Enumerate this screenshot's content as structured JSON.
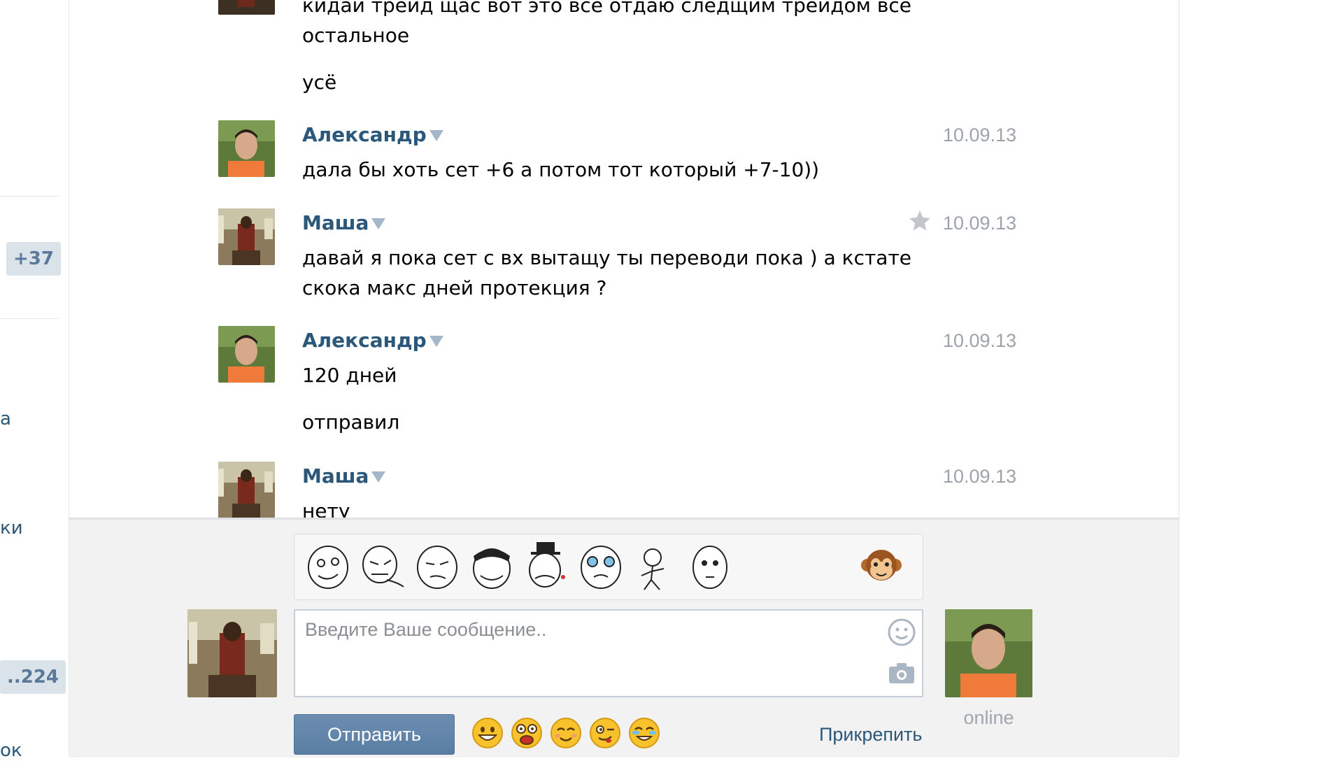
{
  "sidebar": {
    "badge_top": "+37",
    "badge_bottom": "..224",
    "frag_1": "а",
    "frag_2": "ки",
    "frag_3": "ок"
  },
  "messages": [
    {
      "author": "",
      "date": "",
      "texts": [
        "кидаи треид щас вот это все отдаю следщим треидом все остальное",
        "усё"
      ]
    },
    {
      "author": "Александр",
      "date": "10.09.13",
      "texts": [
        "дала бы хоть сет +6 а потом тот который +7-10))"
      ]
    },
    {
      "author": "Маша",
      "date": "10.09.13",
      "texts": [
        "давай я пока сет с вх вытащу ты переводи пока ) а кстате скока макс дней протекция ?"
      ]
    },
    {
      "author": "Александр",
      "date": "10.09.13",
      "texts": [
        "120 дней",
        "отправил"
      ]
    },
    {
      "author": "Маша",
      "date": "10.09.13",
      "texts": [
        "нету"
      ]
    }
  ],
  "composer": {
    "placeholder": "Введите Ваше сообщение..",
    "send_label": "Отправить",
    "attach_label": "Прикрепить",
    "status": "online"
  },
  "icons": {
    "check": "check-icon",
    "star": "star-icon",
    "smile": "smile-icon",
    "camera": "camera-icon",
    "monkey": "monkey-icon"
  },
  "colors": {
    "link": "#2b587a",
    "date": "#9da3ab",
    "send_button": "#5a7ea3",
    "composer_bg": "#f2f2f2"
  }
}
